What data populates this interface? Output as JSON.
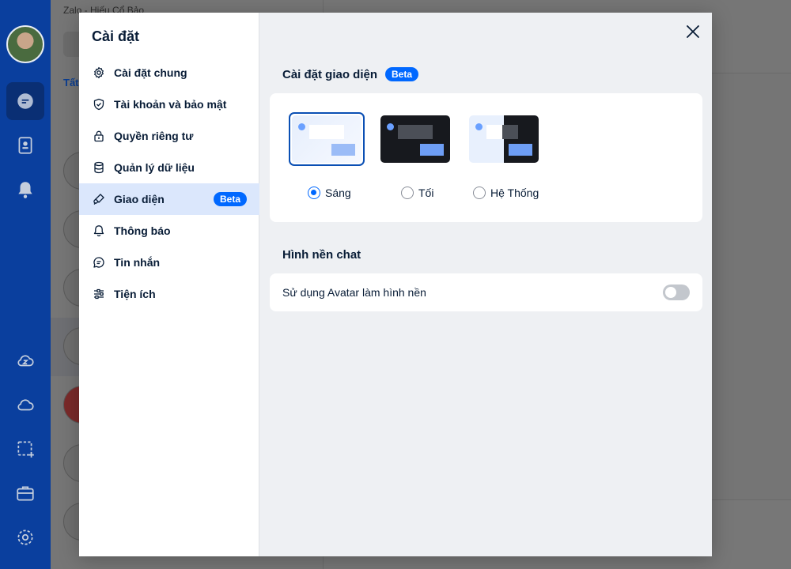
{
  "window": {
    "title": "Zalo - Hiếu Cổ Bảo"
  },
  "background": {
    "tab_label": "Tất"
  },
  "settings": {
    "title": "Cài đặt",
    "menu": [
      {
        "label": "Cài đặt chung",
        "icon": "gear-icon"
      },
      {
        "label": "Tài khoản và bảo mật",
        "icon": "shield-icon"
      },
      {
        "label": "Quyền riêng tư",
        "icon": "lock-icon"
      },
      {
        "label": "Quản lý dữ liệu",
        "icon": "database-icon"
      },
      {
        "label": "Giao diện",
        "icon": "brush-icon",
        "badge": "Beta",
        "active": true
      },
      {
        "label": "Thông báo",
        "icon": "bell-icon"
      },
      {
        "label": "Tin nhắn",
        "icon": "chat-icon"
      },
      {
        "label": "Tiện ích",
        "icon": "sliders-icon"
      }
    ],
    "appearance": {
      "title": "Cài đặt giao diện",
      "badge": "Beta",
      "options": [
        {
          "label": "Sáng",
          "selected": true
        },
        {
          "label": "Tối",
          "selected": false
        },
        {
          "label": "Hệ Thống",
          "selected": false
        }
      ]
    },
    "chat_background": {
      "title": "Hình nền chat",
      "toggle_label": "Sử dụng Avatar làm hình nền",
      "toggle_on": false
    }
  },
  "colors": {
    "accent": "#0068ff",
    "nav": "#0a3f9e",
    "active_bg": "#dbe7fc"
  }
}
